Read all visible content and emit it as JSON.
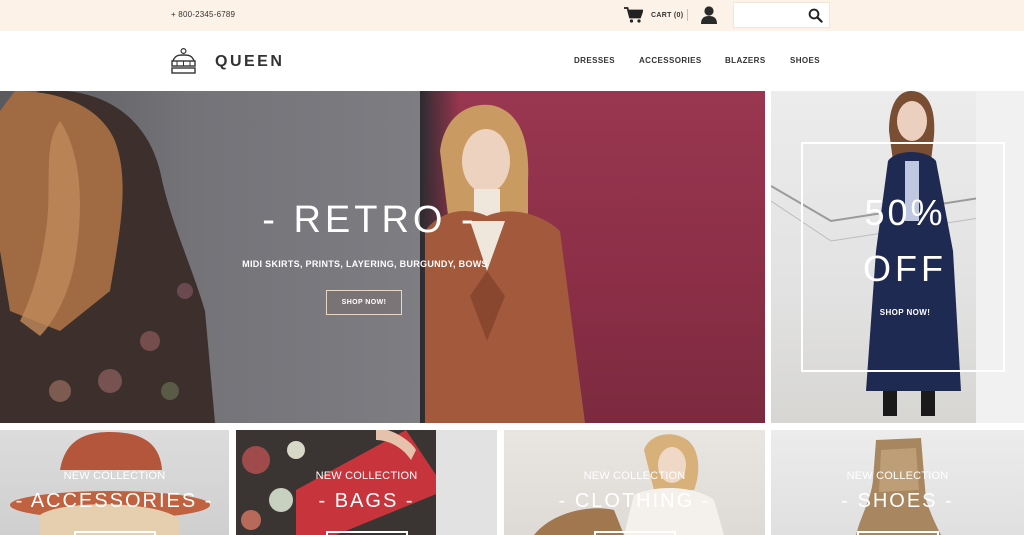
{
  "topbar": {
    "phone": "+ 800-2345-6789",
    "cart_label": "CART (0)",
    "search_placeholder": ""
  },
  "header": {
    "logo_text": "QUEEN",
    "nav": [
      "DRESSES",
      "ACCESSORIES",
      "BLAZERS",
      "SHOES"
    ]
  },
  "hero": {
    "title": "- RETRO -",
    "subtitle": "MIDI SKIRTS, PRINTS, LAYERING, BURGUNDY, BOWS",
    "button": "SHOP NOW!"
  },
  "promo": {
    "line1": "50%",
    "line2": "OFF",
    "button": "SHOP NOW!"
  },
  "categories": [
    {
      "kicker": "NEW COLLECTION",
      "name": "- ACCESSORIES -"
    },
    {
      "kicker": "NEW COLLECTION",
      "name": "- BAGS -"
    },
    {
      "kicker": "NEW COLLECTION",
      "name": "- CLOTHING -"
    },
    {
      "kicker": "NEW COLLECTION",
      "name": "- SHOES -"
    }
  ],
  "icons": {
    "cart": "shopping-cart-icon",
    "user": "user-icon",
    "search": "search-icon",
    "logo": "crown-icon"
  },
  "colors": {
    "topbar_bg": "#fdf2e7",
    "text_dark": "#333333",
    "hero_burgundy": "#8a2e46",
    "button_border": "#e8d6c6"
  }
}
